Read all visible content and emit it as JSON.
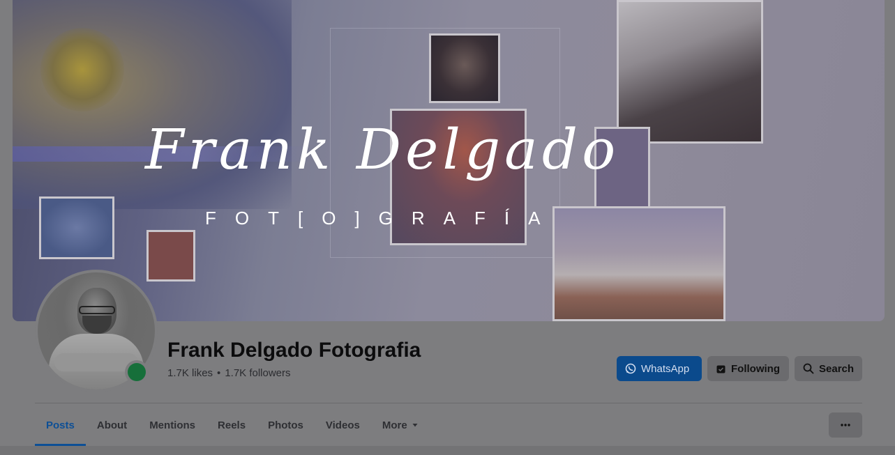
{
  "cover": {
    "script_title": "Frank Delgado",
    "subtitle": "FOT[O]GRAFÍA"
  },
  "page": {
    "name": "Frank Delgado Fotografia",
    "likes": "1.7K likes",
    "followers": "1.7K followers",
    "online": true
  },
  "actions": {
    "whatsapp_label": "WhatsApp",
    "following_label": "Following",
    "search_label": "Search"
  },
  "tabs": [
    {
      "label": "Posts",
      "active": true
    },
    {
      "label": "About",
      "active": false
    },
    {
      "label": "Mentions",
      "active": false
    },
    {
      "label": "Reels",
      "active": false
    },
    {
      "label": "Photos",
      "active": false
    },
    {
      "label": "Videos",
      "active": false
    },
    {
      "label": "More",
      "active": false
    }
  ],
  "colors": {
    "accent": "#0d4f96",
    "whatsapp_button": "#0b4a8c",
    "online_indicator": "#166f3a"
  },
  "icons": {
    "whatsapp": "whatsapp-icon",
    "following": "following-check-icon",
    "search": "search-icon",
    "more_dropdown": "caret-down-icon",
    "overflow": "more-horizontal-icon"
  }
}
